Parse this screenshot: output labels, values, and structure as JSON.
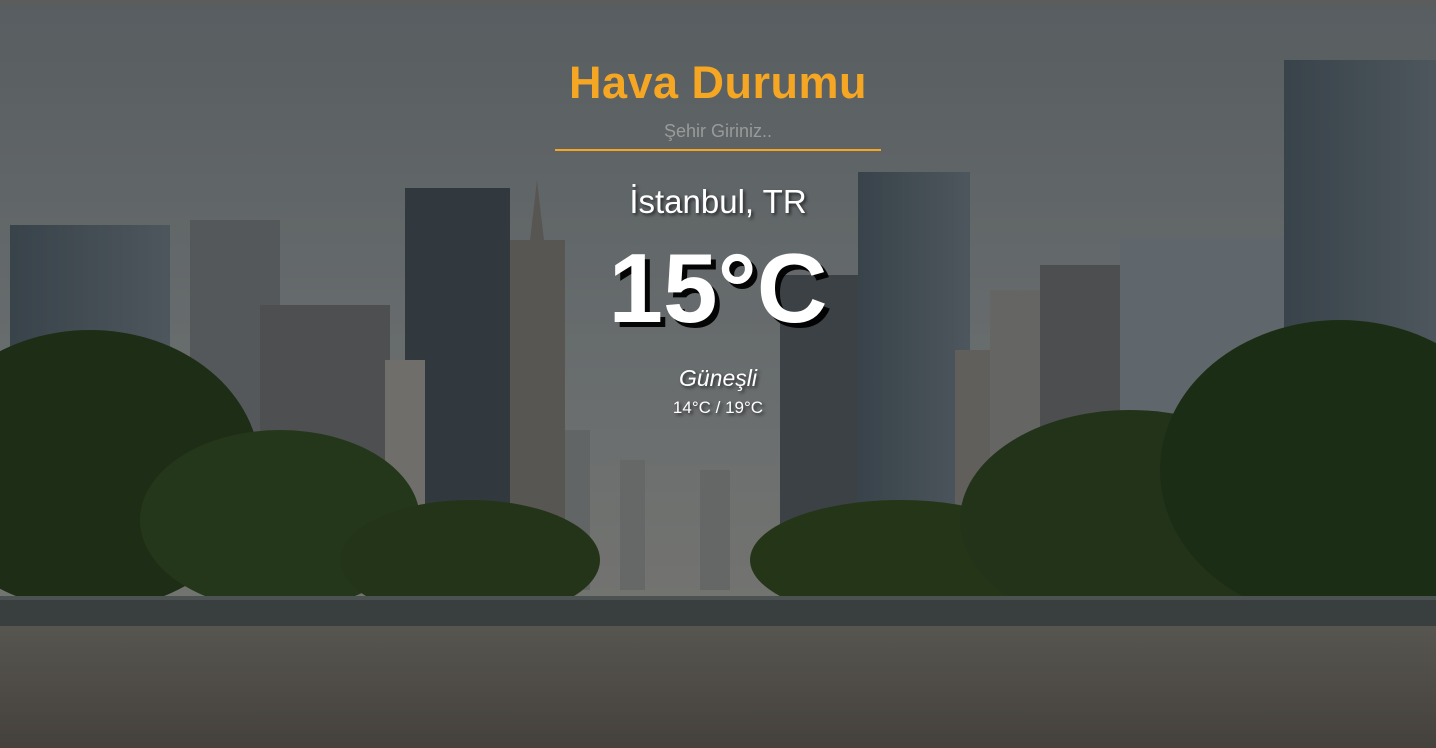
{
  "header": {
    "title": "Hava Durumu"
  },
  "search": {
    "placeholder": "Şehir Giriniz..",
    "value": ""
  },
  "weather": {
    "city": "İstanbul, TR",
    "temperature": "15°C",
    "description": "Güneşli",
    "range": "14°C / 19°C"
  },
  "colors": {
    "accent": "#f5a623",
    "text": "#ffffff"
  }
}
